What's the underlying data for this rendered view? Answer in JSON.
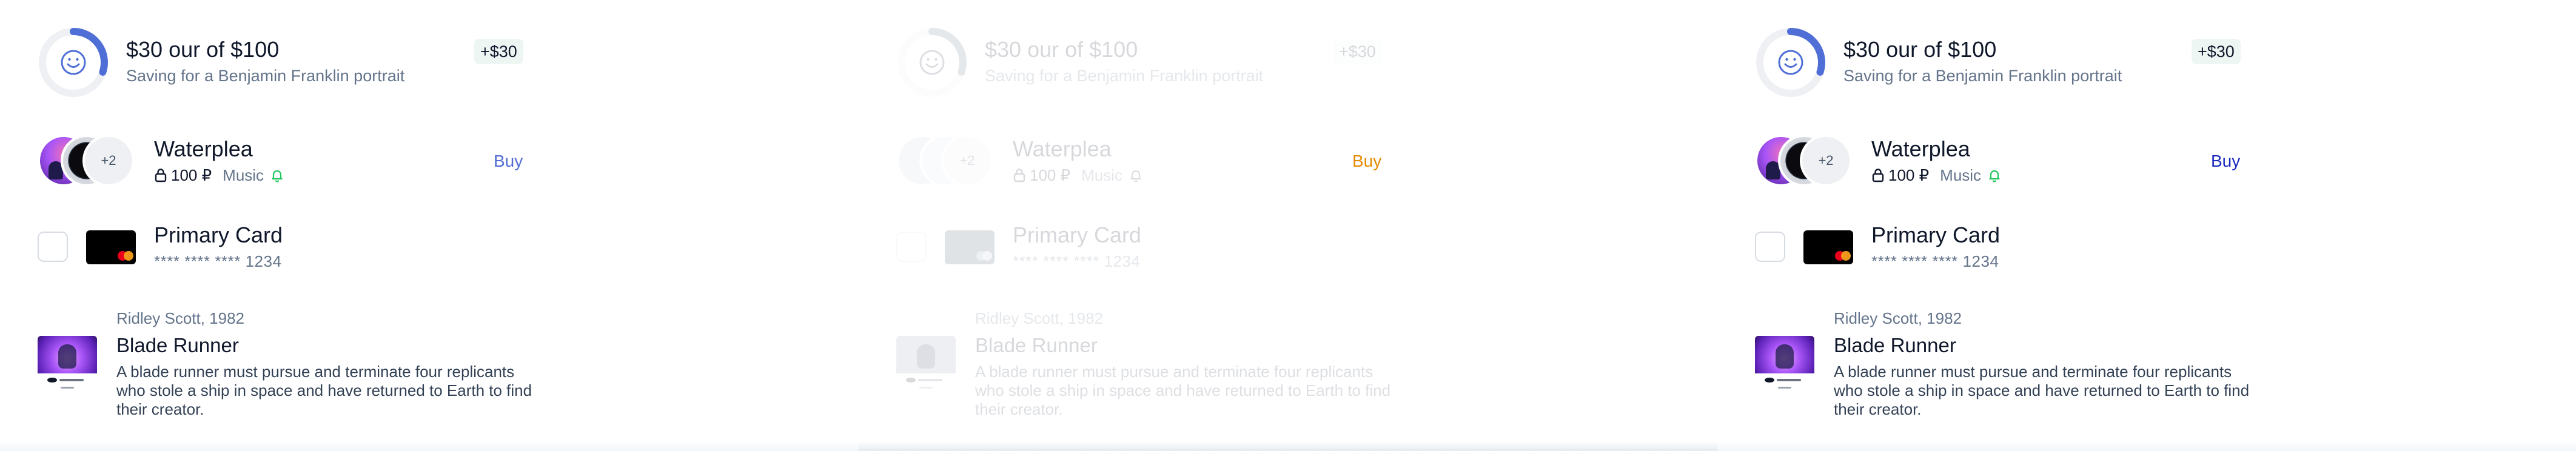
{
  "panels": [
    {
      "goal": {
        "title": "$30 our of $100",
        "subtitle": "Saving for a Benjamin Franklin portrait",
        "badge": "+$30",
        "progress_fraction": 0.3,
        "icon": "smile-icon"
      },
      "product": {
        "name": "Waterplea",
        "price": "100 ₽",
        "genre": "Music",
        "avatars_more": "+2",
        "buy_label": "Buy",
        "buy_color": "#526ed3"
      },
      "card": {
        "name": "Primary Card",
        "number": "**** **** **** 1234"
      },
      "movie": {
        "meta": "Ridley Scott, 1982",
        "title": "Blade Runner",
        "description": "A blade runner must pursue and terminate four replicants who stole a ship in space and have returned to Earth to find their creator."
      }
    },
    {
      "goal": {
        "title": "$30 our of $100",
        "subtitle": "Saving for a Benjamin Franklin portrait",
        "badge": "+$30",
        "progress_fraction": 0.3,
        "icon": "smile-icon"
      },
      "product": {
        "name": "Waterplea",
        "price": "100 ₽",
        "genre": "Music",
        "avatars_more": "+2",
        "buy_label": "Buy",
        "buy_color": "#e58a00"
      },
      "card": {
        "name": "Primary Card",
        "number": "**** **** **** 1234"
      },
      "movie": {
        "meta": "Ridley Scott, 1982",
        "title": "Blade Runner",
        "description": "A blade runner must pursue and terminate four replicants who stole a ship in space and have returned to Earth to find their creator."
      }
    },
    {
      "goal": {
        "title": "$30 our of $100",
        "subtitle": "Saving for a Benjamin Franklin portrait",
        "badge": "+$30",
        "progress_fraction": 0.3,
        "icon": "smile-icon"
      },
      "product": {
        "name": "Waterplea",
        "price": "100 ₽",
        "genre": "Music",
        "avatars_more": "+2",
        "buy_label": "Buy",
        "buy_color": "#1d2ac0"
      },
      "card": {
        "name": "Primary Card",
        "number": "**** **** **** 1234"
      },
      "movie": {
        "meta": "Ridley Scott, 1982",
        "title": "Blade Runner",
        "description": "A blade runner must pursue and terminate four replicants who stole a ship in space and have returned to Earth to find their creator."
      }
    }
  ],
  "colors": {
    "ring_track": "#eef0f4",
    "ring_progress": "#4f6fd6",
    "positive_badge_bg": "#eef6f4",
    "bell_green": "#22c55e"
  }
}
